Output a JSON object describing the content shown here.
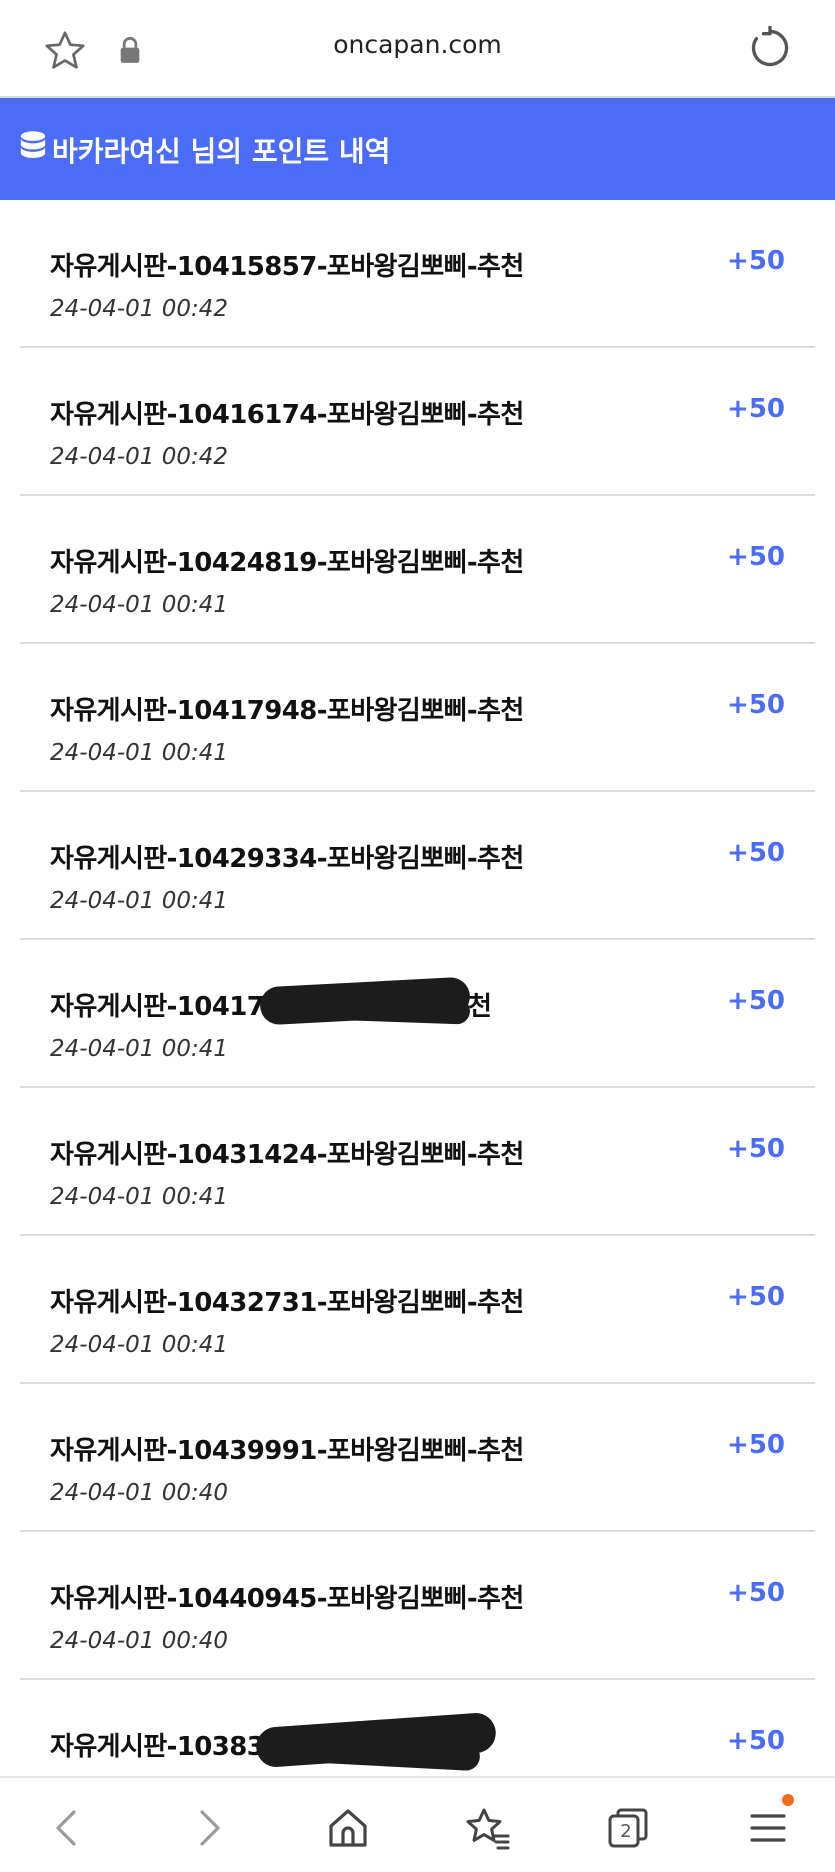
{
  "browser": {
    "url": "oncapan.com"
  },
  "header": {
    "title": "바카라여신 님의 포인트 내역"
  },
  "entries": [
    {
      "title": "자유게시판-10415857-포바왕김뽀삐-추천",
      "date": "24-04-01 00:42",
      "points": "+50"
    },
    {
      "title": "자유게시판-10416174-포바왕김뽀삐-추천",
      "date": "24-04-01 00:42",
      "points": "+50"
    },
    {
      "title": "자유게시판-10424819-포바왕김뽀삐-추천",
      "date": "24-04-01 00:41",
      "points": "+50"
    },
    {
      "title": "자유게시판-10417948-포바왕김뽀삐-추천",
      "date": "24-04-01 00:41",
      "points": "+50"
    },
    {
      "title": "자유게시판-10429334-포바왕김뽀삐-추천",
      "date": "24-04-01 00:41",
      "points": "+50"
    },
    {
      "title": "자유게시판-1041794",
      "title_tail": "천",
      "date": "24-04-01 00:41",
      "points": "+50"
    },
    {
      "title": "자유게시판-10431424-포바왕김뽀삐-추천",
      "date": "24-04-01 00:41",
      "points": "+50"
    },
    {
      "title": "자유게시판-10432731-포바왕김뽀삐-추천",
      "date": "24-04-01 00:41",
      "points": "+50"
    },
    {
      "title": "자유게시판-10439991-포바왕김뽀삐-추천",
      "date": "24-04-01 00:40",
      "points": "+50"
    },
    {
      "title": "자유게시판-10440945-포바왕김뽀삐-추천",
      "date": "24-04-01 00:40",
      "points": "+50"
    },
    {
      "title": "자유게시판-103833",
      "date": "",
      "points": "+50"
    }
  ],
  "bottom_nav": {
    "tab_count": "2",
    "icons": [
      "back-icon",
      "forward-icon",
      "home-icon",
      "bookmarks-icon",
      "tabs-icon",
      "menu-icon"
    ],
    "badge_color": "#f26b1d"
  },
  "colors": {
    "accent": "#4a6cf7"
  }
}
